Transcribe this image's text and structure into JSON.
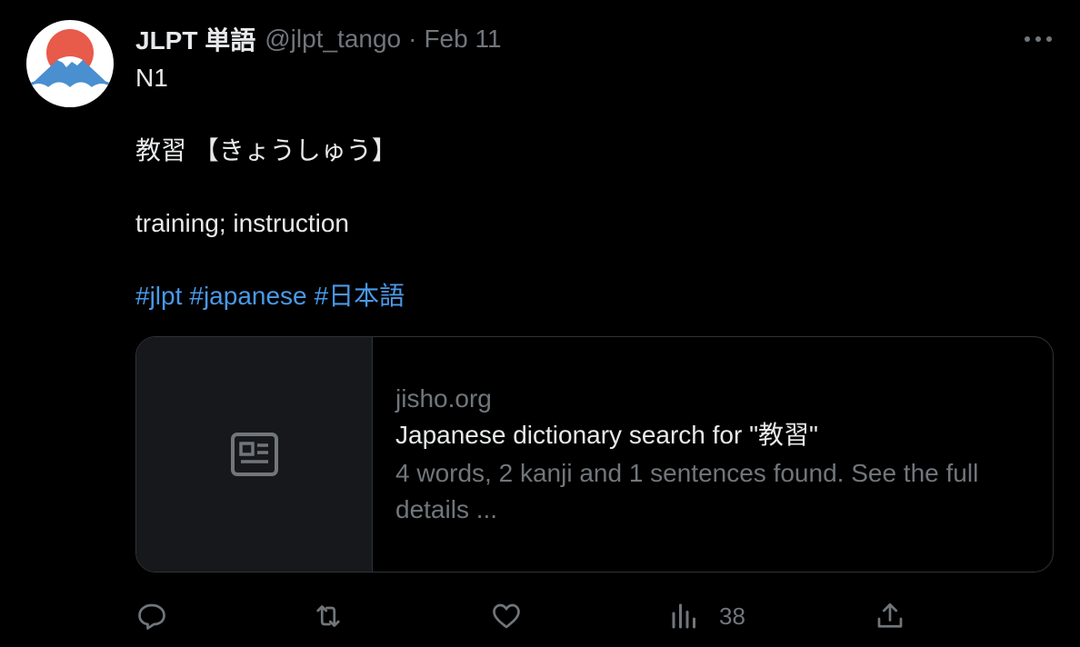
{
  "tweet": {
    "display_name": "JLPT 単語",
    "handle": "@jlpt_tango",
    "separator": "·",
    "date": "Feb 11",
    "lines": {
      "level": "N1",
      "word": "教習 【きょうしゅう】",
      "meaning": "training; instruction"
    },
    "hashtags": [
      "#jlpt",
      "#japanese",
      "#日本語"
    ],
    "hashtag_color": "#4a99e9"
  },
  "card": {
    "domain": "jisho.org",
    "title": "Japanese dictionary search for \"教習\"",
    "description": "4 words, 2 kanji and 1 sentences found. See the full details ...",
    "thumbnail_icon": "article-icon"
  },
  "actions": {
    "reply_icon": "reply-icon",
    "retweet_icon": "retweet-icon",
    "like_icon": "like-icon",
    "views_icon": "views-icon",
    "views_count": "38",
    "share_icon": "share-icon"
  },
  "menu_icon": "more-icon",
  "colors": {
    "background": "#000000",
    "text_primary": "#e7e9ea",
    "text_secondary": "#71767b",
    "border": "#2f3336",
    "avatar_sun": "#e85a4a",
    "avatar_mountain": "#4a8fd0"
  }
}
